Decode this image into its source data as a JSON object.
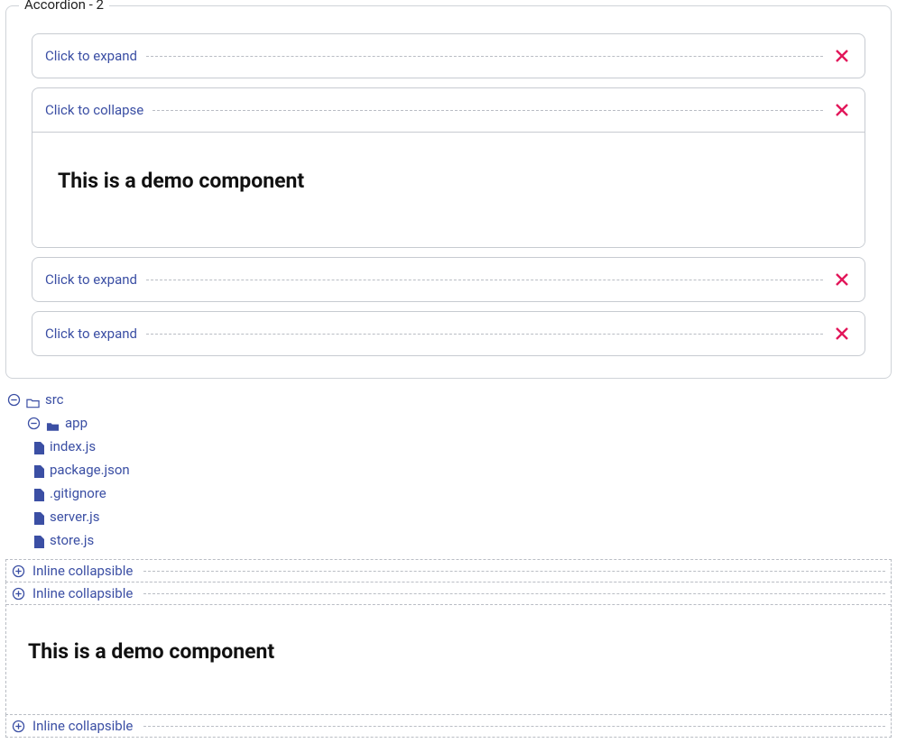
{
  "group": {
    "title": "Accordion - 2",
    "items": [
      {
        "label": "Click to expand",
        "open": false
      },
      {
        "label": "Click to collapse",
        "open": true,
        "body_heading": "This is a demo component"
      },
      {
        "label": "Click to expand",
        "open": false
      },
      {
        "label": "Click to expand",
        "open": false
      }
    ]
  },
  "tree": {
    "root": {
      "label": "src"
    },
    "child": {
      "label": "app"
    },
    "files": [
      "index.js",
      "package.json",
      ".gitignore",
      "server.js",
      "store.js"
    ]
  },
  "inline": {
    "items": [
      {
        "label": "Inline collapsible",
        "open": false
      },
      {
        "label": "Inline collapsible",
        "open": true,
        "body_heading": "This is a demo component"
      },
      {
        "label": "Inline collapsible",
        "open": false
      }
    ]
  }
}
